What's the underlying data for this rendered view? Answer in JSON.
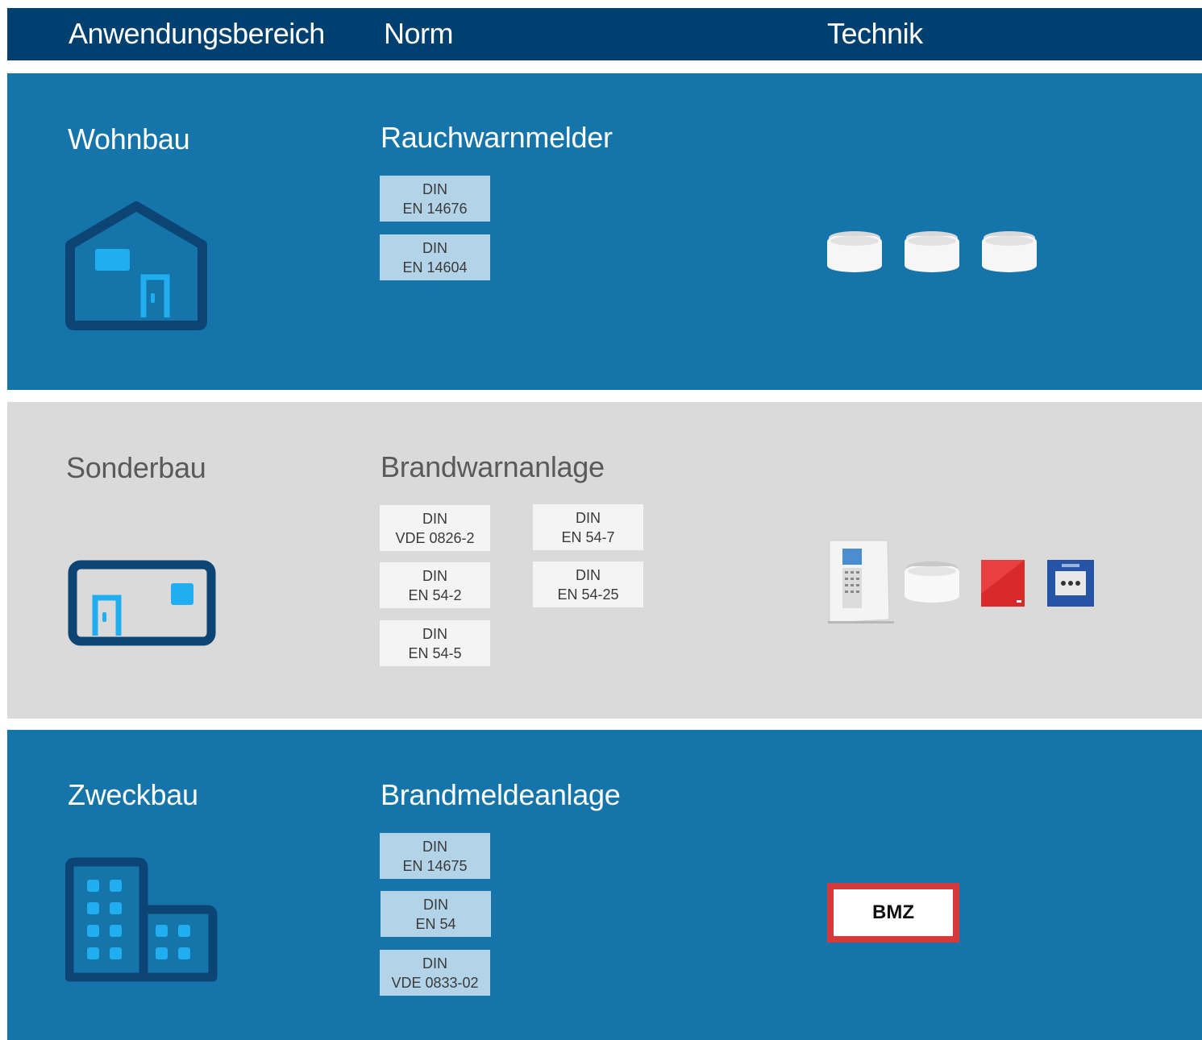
{
  "header": {
    "col_area": "Anwendungsbereich",
    "col_norm": "Norm",
    "col_tech": "Technik"
  },
  "rows": [
    {
      "area": "Wohnbau",
      "norm_title": "Rauchwarnmelder",
      "norms": [
        {
          "line1": "DIN",
          "line2": "EN 14676"
        },
        {
          "line1": "DIN",
          "line2": "EN 14604"
        }
      ],
      "icon": "house-icon",
      "tech": "smoke-detectors"
    },
    {
      "area": "Sonderbau",
      "norm_title": "Brandwarnanlage",
      "norms": [
        {
          "line1": "DIN",
          "line2": "VDE 0826-2"
        },
        {
          "line1": "DIN",
          "line2": "EN 54-7"
        },
        {
          "line1": "DIN",
          "line2": "EN 54-2"
        },
        {
          "line1": "DIN",
          "line2": "EN 54-25"
        },
        {
          "line1": "DIN",
          "line2": "EN 54-5"
        }
      ],
      "icon": "flat-building-icon",
      "tech": "warning-system-devices"
    },
    {
      "area": "Zweckbau",
      "norm_title": "Brandmeldeanlage",
      "norms": [
        {
          "line1": "DIN",
          "line2": "EN 14675"
        },
        {
          "line1": "DIN",
          "line2": "EN 54"
        },
        {
          "line1": "DIN",
          "line2": "VDE 0833-02"
        }
      ],
      "icon": "office-buildings-icon",
      "tech_label": "BMZ"
    }
  ],
  "colors": {
    "header": "#004070",
    "row_blue": "#1575aa",
    "row_grey": "#dadada",
    "icon_dark": "#0c4474",
    "icon_light": "#20aef0",
    "bmz_border": "#d43a3a"
  }
}
